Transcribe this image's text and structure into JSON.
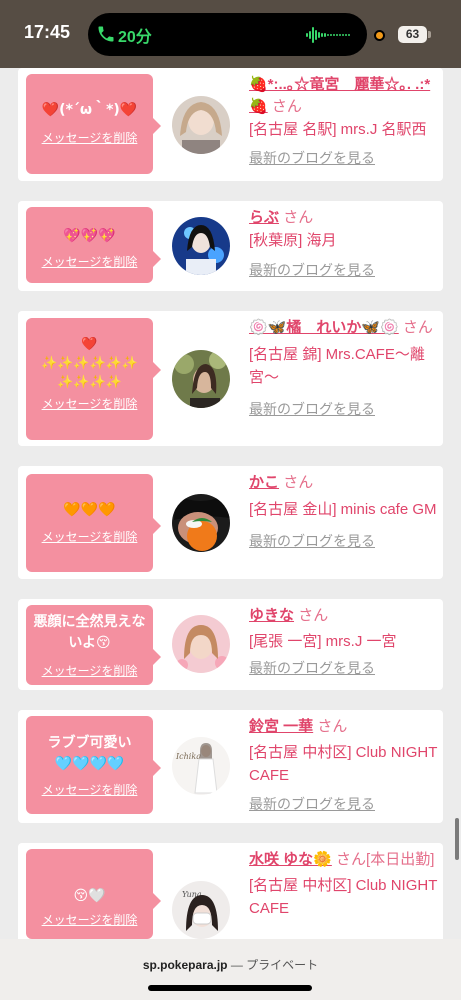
{
  "status_bar": {
    "time": "17:45",
    "call_timer": "20分",
    "battery": "63"
  },
  "entries": [
    {
      "message": "❤️(*´ω｀*)❤️",
      "delete_label": "メッセージを削除",
      "name": "🍓*:..｡☆竜宮　麗華☆｡. .:*🍓",
      "honorific": "さん",
      "shop": "[名古屋 名駅] mrs.J 名駅西",
      "blog_link": "最新のブログを見る"
    },
    {
      "message": "💖💖💖",
      "delete_label": "メッセージを削除",
      "name": "らぶ",
      "honorific": "さん",
      "shop": "[秋葉原] 海月",
      "blog_link": "最新のブログを見る"
    },
    {
      "message": "❤️\n✨✨✨✨✨✨\n✨✨✨✨",
      "delete_label": "メッセージを削除",
      "name": "🍥🦋橘　れいか🦋🍥",
      "honorific": "さん",
      "shop": "[名古屋 錦] Mrs.CAFE〜離宮〜",
      "blog_link": "最新のブログを見る"
    },
    {
      "message": "🧡🧡🧡",
      "delete_label": "メッセージを削除",
      "name": "かこ",
      "honorific": "さん",
      "shop": "[名古屋 金山] minis cafe GM",
      "blog_link": "最新のブログを見る"
    },
    {
      "message": "悪顔に全然見えないよ😚",
      "delete_label": "メッセージを削除",
      "name": "ゆきな",
      "honorific": "さん",
      "shop": "[尾張 一宮] mrs.J 一宮",
      "blog_link": "最新のブログを見る"
    },
    {
      "message": "ラブブ可愛い🩵🩵🩵🩵",
      "delete_label": "メッセージを削除",
      "name": "鈴宮 一華",
      "honorific": "さん",
      "shop": "[名古屋 中村区] Club NIGHT CAFE",
      "blog_link": "最新のブログを見る"
    },
    {
      "message": "😚🤍",
      "delete_label": "メッセージを削除",
      "name": "水咲 ゆな🌼",
      "honorific": "さん[本日出勤]",
      "shop": "[名古屋 中村区] Club NIGHT CAFE",
      "blog_link": ""
    }
  ],
  "url_bar": {
    "domain": "sp.pokepara.jp",
    "mode": " — プライベート"
  }
}
